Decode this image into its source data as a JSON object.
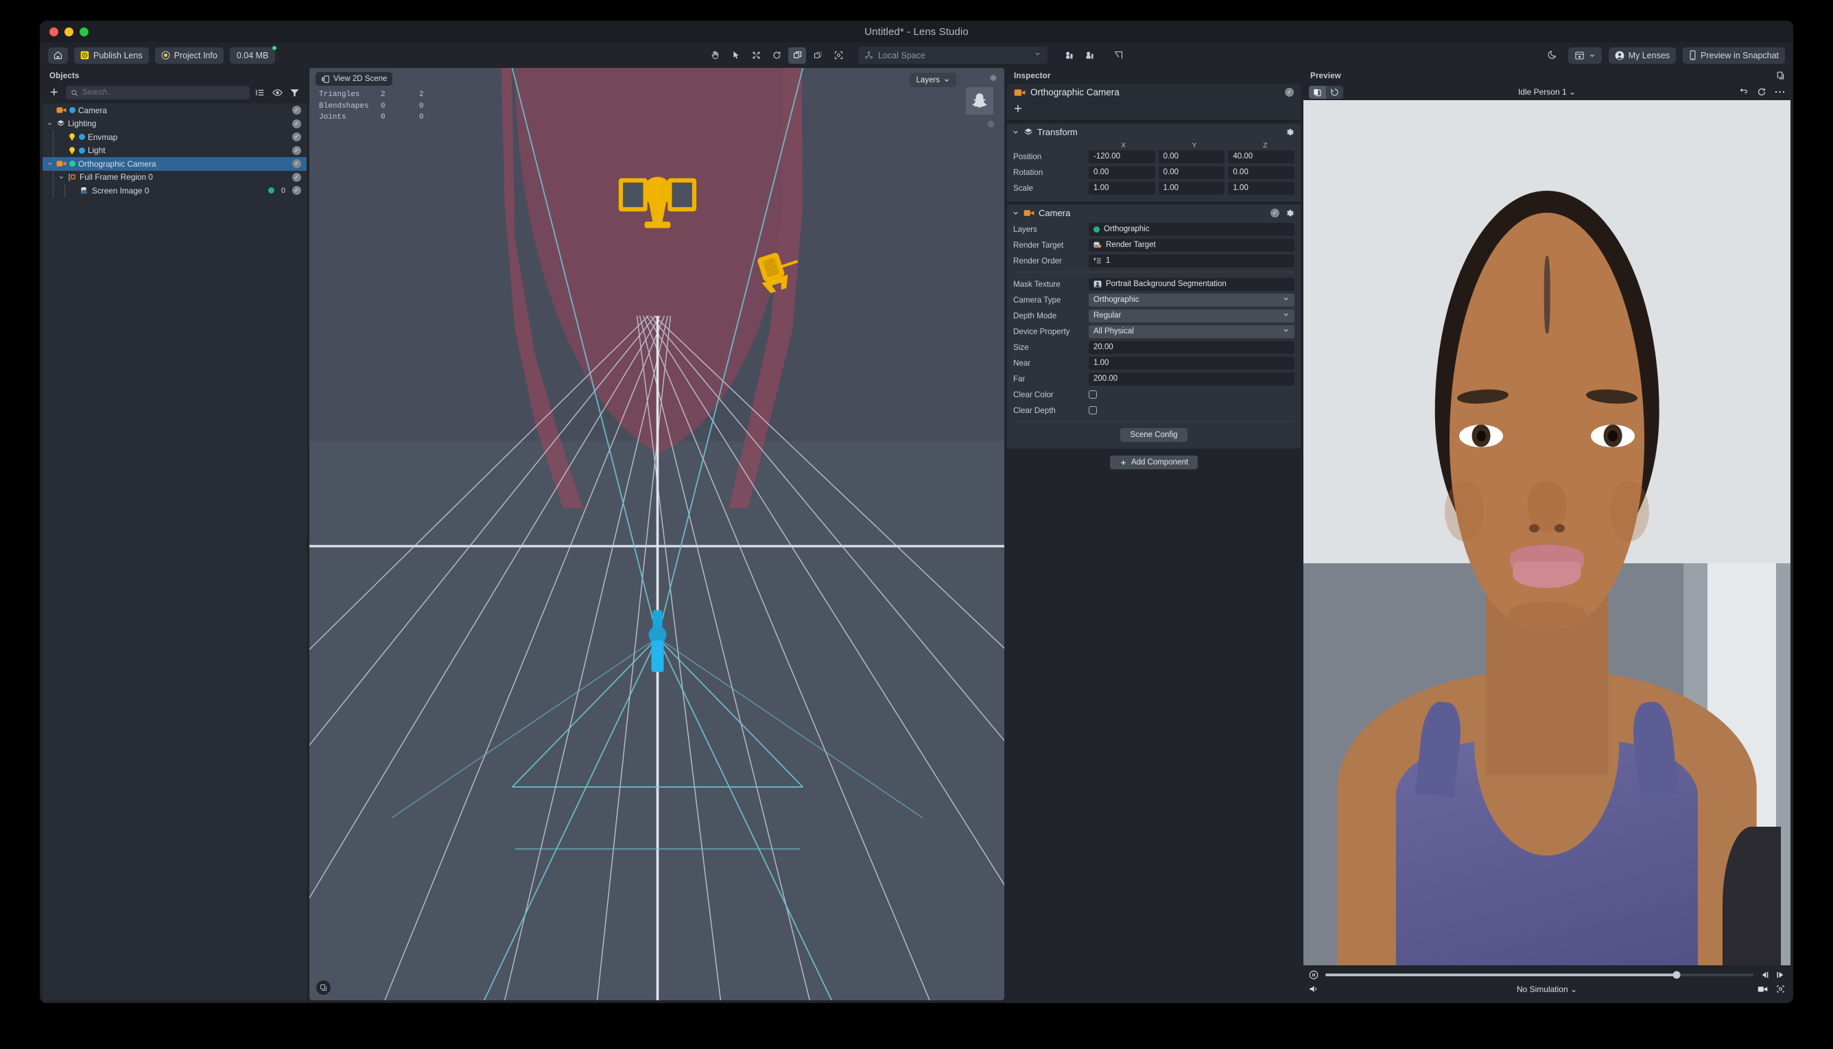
{
  "window": {
    "title": "Untitled* - Lens Studio"
  },
  "toolbar": {
    "home_icon": "home-icon",
    "publish_lens_label": "Publish Lens",
    "project_info_label": "Project Info",
    "project_size": "0.04 MB",
    "tools": [
      {
        "name": "hand-tool-icon",
        "active": false
      },
      {
        "name": "select-tool-icon",
        "active": false
      },
      {
        "name": "move-tool-icon",
        "active": false
      },
      {
        "name": "rotate-tool-icon",
        "active": false
      },
      {
        "name": "scale-tool-icon",
        "active": true
      },
      {
        "name": "rect-transform-tool-icon",
        "active": false
      },
      {
        "name": "universal-tool-icon",
        "active": false
      }
    ],
    "space_value": "Local Space",
    "dark_mode_icon": "moon-icon",
    "new_window_label": "",
    "my_lenses_label": "My Lenses",
    "preview_in_snapchat_label": "Preview in Snapchat"
  },
  "objects_panel": {
    "title": "Objects",
    "search_placeholder": "Search...",
    "add_label": "+",
    "header_icons": [
      "sort-icon",
      "visibility-icon",
      "filter-icon"
    ],
    "items": [
      {
        "label": "Camera",
        "depth": 0,
        "twisty": "",
        "icon": "camera-icon",
        "orb": "blue",
        "enabled": true,
        "selected": false,
        "count": ""
      },
      {
        "label": "Lighting",
        "depth": 0,
        "twisty": "down",
        "icon": "object-icon",
        "orb": "",
        "enabled": true,
        "selected": false,
        "count": ""
      },
      {
        "label": "Envmap",
        "depth": 1,
        "twisty": "",
        "icon": "light-icon",
        "orb": "blue",
        "enabled": true,
        "selected": false,
        "count": ""
      },
      {
        "label": "Light",
        "depth": 1,
        "twisty": "",
        "icon": "light-icon",
        "orb": "blue",
        "enabled": true,
        "selected": false,
        "count": ""
      },
      {
        "label": "Orthographic Camera",
        "depth": 0,
        "twisty": "down",
        "icon": "camera-icon",
        "orb": "green",
        "enabled": true,
        "selected": true,
        "count": ""
      },
      {
        "label": "Full Frame Region 0",
        "depth": 1,
        "twisty": "down",
        "icon": "screen-region-icon",
        "orb": "",
        "enabled": true,
        "selected": false,
        "count": ""
      },
      {
        "label": "Screen Image 0",
        "depth": 2,
        "twisty": "",
        "icon": "screen-image-icon",
        "orb": "",
        "enabled": true,
        "selected": false,
        "count": "0",
        "green_dot": true
      }
    ]
  },
  "viewport": {
    "view_mode_label": "View 2D Scene",
    "stats": [
      {
        "label": "Triangles",
        "a": "2",
        "b": "2"
      },
      {
        "label": "Blendshapes",
        "a": "0",
        "b": "0"
      },
      {
        "label": "Joints",
        "a": "0",
        "b": "0"
      }
    ],
    "layers_label": "Layers",
    "gizmo_icon": "snapchat-ghost-icon",
    "gear_icon": "gear-icon",
    "home_icon": "home-icon",
    "corner_icon": "view-2d-icon"
  },
  "inspector": {
    "title": "Inspector",
    "object_name": "Orthographic Camera",
    "object_enabled": true,
    "add_label": "+",
    "transform": {
      "title": "Transform",
      "axes": [
        "X",
        "Y",
        "Z"
      ],
      "rows": [
        {
          "label": "Position",
          "values": [
            "-120.00",
            "0.00",
            "40.00"
          ]
        },
        {
          "label": "Rotation",
          "values": [
            "0.00",
            "0.00",
            "0.00"
          ]
        },
        {
          "label": "Scale",
          "values": [
            "1.00",
            "1.00",
            "1.00"
          ]
        }
      ]
    },
    "camera": {
      "title": "Camera",
      "enabled": true,
      "layers_label": "Layers",
      "layers_value": "Orthographic",
      "render_target_label": "Render Target",
      "render_target_value": "Render Target",
      "render_order_label": "Render Order",
      "render_order_value": "1",
      "mask_texture_label": "Mask Texture",
      "mask_texture_value": "Portrait Background Segmentation",
      "camera_type_label": "Camera Type",
      "camera_type_value": "Orthographic",
      "depth_mode_label": "Depth Mode",
      "depth_mode_value": "Regular",
      "device_property_label": "Device Property",
      "device_property_value": "All Physical",
      "size_label": "Size",
      "size_value": "20.00",
      "near_label": "Near",
      "near_value": "1.00",
      "far_label": "Far",
      "far_value": "200.00",
      "clear_color_label": "Clear Color",
      "clear_color_checked": false,
      "clear_depth_label": "Clear Depth",
      "clear_depth_checked": false,
      "scene_config_label": "Scene Config"
    },
    "add_component_label": "Add Component"
  },
  "preview": {
    "title": "Preview",
    "subject_label": "Idle Person 1",
    "view_toggle_icons": [
      "split-view-icon",
      "rotate-device-icon"
    ],
    "right_icons": [
      "reset-icon",
      "restart-icon",
      "more-icon"
    ],
    "corner_icon": "popout-icon",
    "timeline_pause_icon": "pause-icon",
    "step_back_icon": "step-back-icon",
    "step_forward_icon": "step-forward-icon",
    "volume_icon": "volume-icon",
    "simulation_label": "No Simulation",
    "record_icon": "record-icon",
    "snapshot_icon": "snapshot-icon",
    "progress_percent": 82
  },
  "colors": {
    "accent_selection": "#2f6496",
    "panel_bg": "#282c34",
    "window_bg": "#21252b",
    "orange_icon": "#e8912d",
    "green_orb": "#19b77e",
    "yellow_gizmo": "#f0b400",
    "frustum_cyan": "#6ec8d8"
  }
}
